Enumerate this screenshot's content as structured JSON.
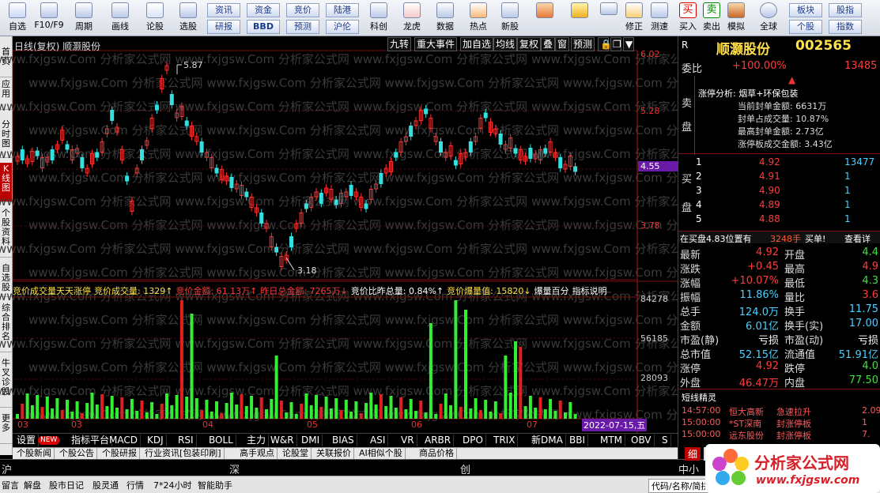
{
  "toolbar": {
    "buttons": [
      {
        "label": "自选",
        "icon": "star-icon"
      },
      {
        "label": "F10/F9",
        "icon": "f10-icon"
      },
      {
        "label": "周期",
        "icon": "clock-icon"
      },
      {
        "label": "画线",
        "icon": "pen-icon"
      },
      {
        "label": "论股",
        "icon": "forum-icon"
      },
      {
        "label": "选股",
        "icon": "select-icon"
      }
    ],
    "grid": [
      [
        "资讯",
        "资金",
        "竞价",
        "陆港"
      ],
      [
        "研报",
        "BBD",
        "预测",
        "沪伦"
      ]
    ],
    "buttons2": [
      {
        "label": "科创",
        "icon": "rocket-icon"
      },
      {
        "label": "龙虎",
        "icon": "dragon-icon"
      },
      {
        "label": "数据",
        "icon": "pe-icon"
      },
      {
        "label": "热点",
        "icon": "fire-icon"
      },
      {
        "label": "新股",
        "icon": "newstock-icon"
      }
    ],
    "buttons3": [
      {
        "label": "修正",
        "icon": "revise-icon"
      },
      {
        "label": "测速",
        "icon": "speed-icon"
      }
    ],
    "buttons4": [
      {
        "label": "买入",
        "icon": "buy-icon"
      },
      {
        "label": "卖出",
        "icon": "sell-icon"
      },
      {
        "label": "模拟",
        "icon": "hammer-icon"
      },
      {
        "label": "全球",
        "icon": "globe-icon"
      }
    ],
    "grid2": [
      [
        "板块",
        "股指"
      ],
      [
        "个股",
        "指数"
      ]
    ]
  },
  "left_tabs": [
    "首页",
    "应用",
    "分时图",
    "K线图",
    "个股资料",
    "自选股",
    "综合排名",
    "牛叉诊股",
    "更多"
  ],
  "chart": {
    "title": "日线(复权) 顺灏股份",
    "controls": [
      "九转",
      "重大事件",
      "加自选",
      "均线",
      "复权",
      "叠",
      "窗",
      "预测"
    ],
    "price_axis": [
      "6.02",
      "5.28",
      "4.55",
      "3.78"
    ],
    "high_label": "5.87",
    "low_label": "3.18",
    "indicator_header": [
      {
        "text": "竞价成交量天天涨停",
        "color": "#ffe04a"
      },
      {
        "text": "竞价成交量: 1329↑",
        "color": "#ffe04a"
      },
      {
        "text": "竞价金额: 61.13万↑",
        "color": "#ff3b3b"
      },
      {
        "text": "昨日总金额: 7265万↓",
        "color": "#ff3b3b"
      },
      {
        "text": "竞价比昨总量: 0.84%↑",
        "color": "#ffffff"
      },
      {
        "text": "竞价爆量值: 15820↓",
        "color": "#ffe04a"
      },
      {
        "text": "爆量百分",
        "color": "#ffffff"
      },
      {
        "text": "指标说明",
        "color": "#ffffff"
      }
    ],
    "vol_axis": [
      "84278",
      "56185",
      "28093"
    ],
    "months": [
      "03",
      "04",
      "05",
      "06",
      "07"
    ],
    "date_cursor": "2022-07-15,五"
  },
  "indicator_tabs": [
    "设置",
    "NEW",
    "指标平台",
    "MACD",
    "KDJ",
    "RSI",
    "BOLL",
    "主力",
    "W&R",
    "DMI",
    "BIAS",
    "ASI",
    "VR",
    "ARBR",
    "DPO",
    "TRIX",
    "新DMA",
    "BBI",
    "MTM",
    "OBV",
    "S"
  ],
  "news_tabs": [
    "个股新闻",
    "个股公告",
    "个股研报",
    "行业资讯[包装印刷]",
    "高手观点",
    "论股堂",
    "关联报价",
    "AI相似个股",
    "商品价格"
  ],
  "index_row": [
    "沪",
    "深",
    "创",
    "中小"
  ],
  "bottom_bar": [
    "留言",
    "解盘",
    "股市日记",
    "股灵通",
    "行情",
    "7*24小时",
    "智能助手",
    "代码/名称/简拼"
  ],
  "quote": {
    "name": "顺灏股份",
    "code": "002565",
    "weibi_label": "委比",
    "weibi": "+100.00%",
    "weicha": "13485",
    "sell_label": [
      "卖",
      "盘"
    ],
    "buy_label": [
      "买",
      "盘"
    ],
    "limit_info": {
      "reason": "涨停分析: 烟草+环保包装",
      "lines": [
        "当前封单金额: 6631万",
        "封单占成交量: 10.87%",
        "最高封单金额: 2.73亿",
        "涨停板成交金额: 3.43亿"
      ]
    },
    "bids": [
      {
        "n": "1",
        "p": "4.92",
        "v": "13477"
      },
      {
        "n": "2",
        "p": "4.91",
        "v": "1"
      },
      {
        "n": "3",
        "p": "4.90",
        "v": "1"
      },
      {
        "n": "4",
        "p": "4.89",
        "v": "1"
      },
      {
        "n": "5",
        "p": "4.88",
        "v": "1"
      }
    ],
    "buy_status": "在买盘4.83位置有",
    "buy_status_vol": "3248手",
    "buy_status2": "买单!",
    "buy_status3": "查看详",
    "stats": [
      {
        "l": "最新",
        "v": "4.92",
        "c": "red",
        "l2": "开盘",
        "v2": "4.4",
        "c2": "grn"
      },
      {
        "l": "涨跌",
        "v": "+0.45",
        "c": "red",
        "l2": "最高",
        "v2": "4.9",
        "c2": "red"
      },
      {
        "l": "涨幅",
        "v": "+10.07%",
        "c": "red",
        "l2": "最低",
        "v2": "4.3",
        "c2": "grn"
      },
      {
        "l": "振幅",
        "v": "11.86%",
        "c": "cya",
        "l2": "量比",
        "v2": "3.6",
        "c2": "red"
      },
      {
        "l": "总手",
        "v": "124.0万",
        "c": "cya",
        "l2": "换手",
        "v2": "11.75",
        "c2": "cya"
      },
      {
        "l": "金额",
        "v": "6.01亿",
        "c": "cya",
        "l2": "换手(实)",
        "v2": "17.00",
        "c2": "cya"
      },
      {
        "l": "市盈(静)",
        "v": "亏损",
        "c": "wht",
        "l2": "市盈(动)",
        "v2": "亏损",
        "c2": "wht"
      },
      {
        "l": "总市值",
        "v": "52.15亿",
        "c": "cya",
        "l2": "流通值",
        "v2": "51.91亿",
        "c2": "cya"
      },
      {
        "l": "涨停",
        "v": "4.92",
        "c": "red",
        "l2": "跌停",
        "v2": "4.0",
        "c2": "grn"
      },
      {
        "l": "外盘",
        "v": "46.47万",
        "c": "red",
        "l2": "内盘",
        "v2": "77.50",
        "c2": "grn"
      }
    ],
    "short_title": "短线精灵",
    "short_rows": [
      {
        "t": "14:57:00",
        "n": "恒大高新",
        "e": "急速拉升",
        "v": "2.09"
      },
      {
        "t": "15:00:00",
        "n": "*ST深南",
        "e": "封涨停板",
        "v": "1"
      },
      {
        "t": "15:00:00",
        "n": "远东股份",
        "e": "封涨停板",
        "v": "7."
      }
    ],
    "tab_labels": [
      "细",
      "分"
    ]
  },
  "logo": {
    "title": "分析家公式网",
    "url": "www.fxjgsw.com"
  },
  "watermark": "www.fxjgsw.Com 分析家公式网"
}
